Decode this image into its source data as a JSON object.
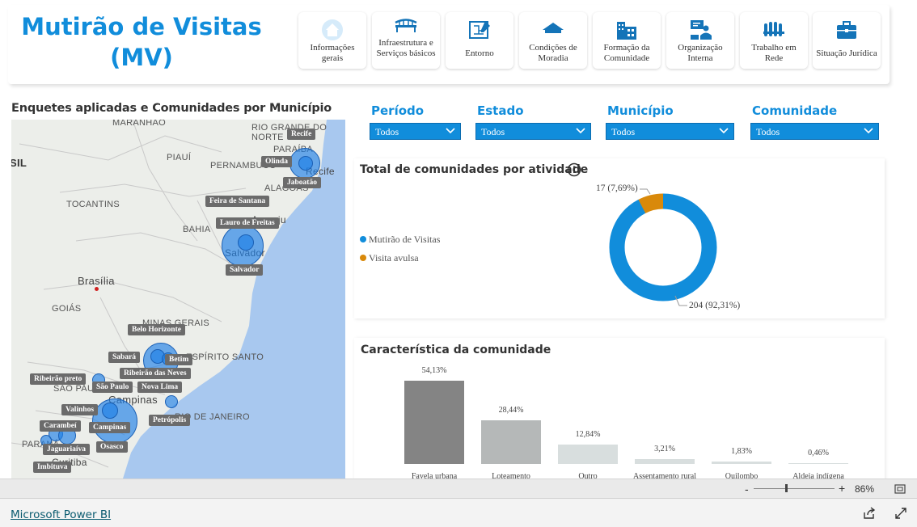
{
  "app": {
    "title": "Mutirão de Visitas (MV)"
  },
  "nav_buttons": [
    {
      "label": "Informações gerais",
      "icon": "house-icon"
    },
    {
      "label": "Infraestrutura e Serviços básicos",
      "icon": "bridge-icon"
    },
    {
      "label": "Entorno",
      "icon": "map-plan-icon"
    },
    {
      "label": "Condições de Moradia",
      "icon": "roof-icon"
    },
    {
      "label": "Formação da Comunidade",
      "icon": "buildings-icon"
    },
    {
      "label": "Organização Interna",
      "icon": "presenter-icon"
    },
    {
      "label": "Trabalho em Rede",
      "icon": "team-icon"
    },
    {
      "label": "Situação Jurídica",
      "icon": "briefcase-icon"
    }
  ],
  "map": {
    "title": "Enquetes aplicadas e Comunidades por Município",
    "states": [
      "MARANHÃO",
      "RIO GRANDE DO NORTE",
      "PARAÍBA",
      "PIAUÍ",
      "PERNAMBUCO",
      "ALAGOAS",
      "TOCANTINS",
      "BAHIA",
      "GOIÁS",
      "MINAS GERAIS",
      "ESPÍRITO SANTO",
      "SÃO PAULO",
      "RIO DE JANEIRO",
      "PARANÁ",
      "SIL"
    ],
    "places": [
      "Recife",
      "Aracaju",
      "Salvador",
      "Brasília",
      "Campinas",
      "Curitiba"
    ],
    "cities": [
      "Recife",
      "Olinda",
      "Jaboatão",
      "Feira de Santana",
      "Lauro de Freitas",
      "Salvador",
      "Belo Horizonte",
      "Sabará",
      "Betim",
      "Ribeirão das Neves",
      "Ribeirão preto",
      "São Paulo",
      "Nova Lima",
      "Valinhos",
      "Petrópolis",
      "Carambeí",
      "Campinas",
      "Jaguariaíva",
      "Osasco",
      "Imbituva"
    ]
  },
  "filters": [
    {
      "label": "Período",
      "value": "Todos"
    },
    {
      "label": "Estado",
      "value": "Todos"
    },
    {
      "label": "Município",
      "value": "Todos"
    },
    {
      "label": "Comunidade",
      "value": "Todos"
    }
  ],
  "colors": {
    "accent": "#118DDB",
    "mutirao": "#118DDB",
    "avulsa": "#D9890A",
    "bar_dark": "#848484",
    "bar_mid": "#b5b8b8",
    "bar_light": "#d8dede"
  },
  "donut_card": {
    "title": "Total de comunidades por atividade",
    "info_icon": "info-icon"
  },
  "bar_card": {
    "title": "Característica da comunidade"
  },
  "chart_data": [
    {
      "type": "pie",
      "title": "Total de comunidades por atividade",
      "categories": [
        "Mutirão de Visitas",
        "Visita avulsa"
      ],
      "values": [
        204,
        17
      ],
      "labels": [
        "204 (92,31%)",
        "17 (7,69%)"
      ],
      "legend": "left"
    },
    {
      "type": "bar",
      "title": "Característica da comunidade",
      "categories": [
        "Favela urbana",
        "Loteamento",
        "Outro",
        "Assentamento rural",
        "Quilombo",
        "Aldeia indígena"
      ],
      "values": [
        54.13,
        28.44,
        12.84,
        3.21,
        1.83,
        0.46
      ],
      "labels": [
        "54,13%",
        "28,44%",
        "12,84%",
        "3,21%",
        "1,83%",
        "0,46%"
      ],
      "ylim": [
        0,
        54.13
      ]
    }
  ],
  "zoom": {
    "minus": "-",
    "plus": "+",
    "level": "86%",
    "value": 86
  },
  "footer": {
    "link": "Microsoft Power BI"
  }
}
